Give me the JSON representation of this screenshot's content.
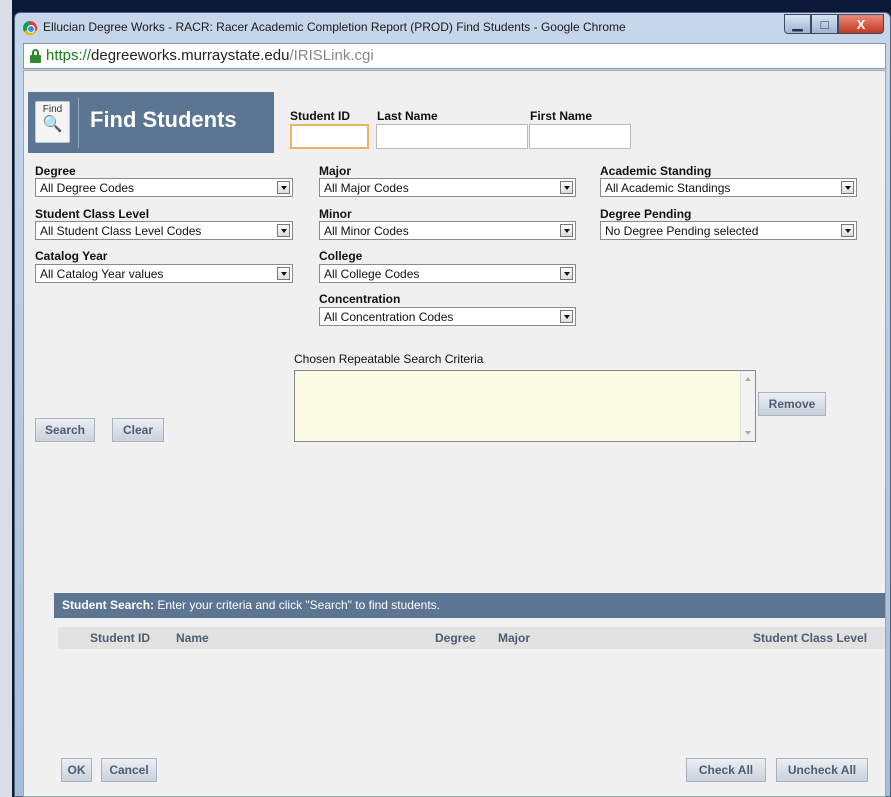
{
  "window": {
    "title": "Ellucian Degree Works - RACR: Racer Academic Completion Report (PROD) Find Students - Google Chrome",
    "min_label": "▁",
    "max_label": "□",
    "close_label": "X",
    "url_scheme": "https://",
    "url_host": "degreeworks.murraystate.edu",
    "url_path": "/IRISLink.cgi"
  },
  "header": {
    "icon_label": "Find",
    "title": "Find Students"
  },
  "search_fields": {
    "student_id_label": "Student ID",
    "last_name_label": "Last Name",
    "first_name_label": "First Name"
  },
  "filters": {
    "degree": {
      "label": "Degree",
      "value": "All Degree Codes"
    },
    "student_class_level": {
      "label": "Student Class Level",
      "value": "All Student Class Level Codes"
    },
    "catalog_year": {
      "label": "Catalog Year",
      "value": "All Catalog Year values"
    },
    "major": {
      "label": "Major",
      "value": "All Major Codes"
    },
    "minor": {
      "label": "Minor",
      "value": "All Minor Codes"
    },
    "college": {
      "label": "College",
      "value": "All College Codes"
    },
    "concentration": {
      "label": "Concentration",
      "value": "All Concentration Codes"
    },
    "academic_standing": {
      "label": "Academic Standing",
      "value": "All Academic Standings"
    },
    "degree_pending": {
      "label": "Degree Pending",
      "value": "No Degree Pending selected"
    }
  },
  "criteria": {
    "label": "Chosen Repeatable Search Criteria",
    "remove_button": "Remove"
  },
  "actions": {
    "search_button": "Search",
    "clear_button": "Clear"
  },
  "results": {
    "header_bold": "Student Search:",
    "header_text": " Enter your criteria and click \"Search\" to find students.",
    "columns": [
      "Student ID",
      "Name",
      "Degree",
      "Major",
      "Student Class Level"
    ]
  },
  "footer": {
    "ok_button": "OK",
    "cancel_button": "Cancel",
    "check_all_button": "Check All",
    "uncheck_all_button": "Uncheck All"
  }
}
